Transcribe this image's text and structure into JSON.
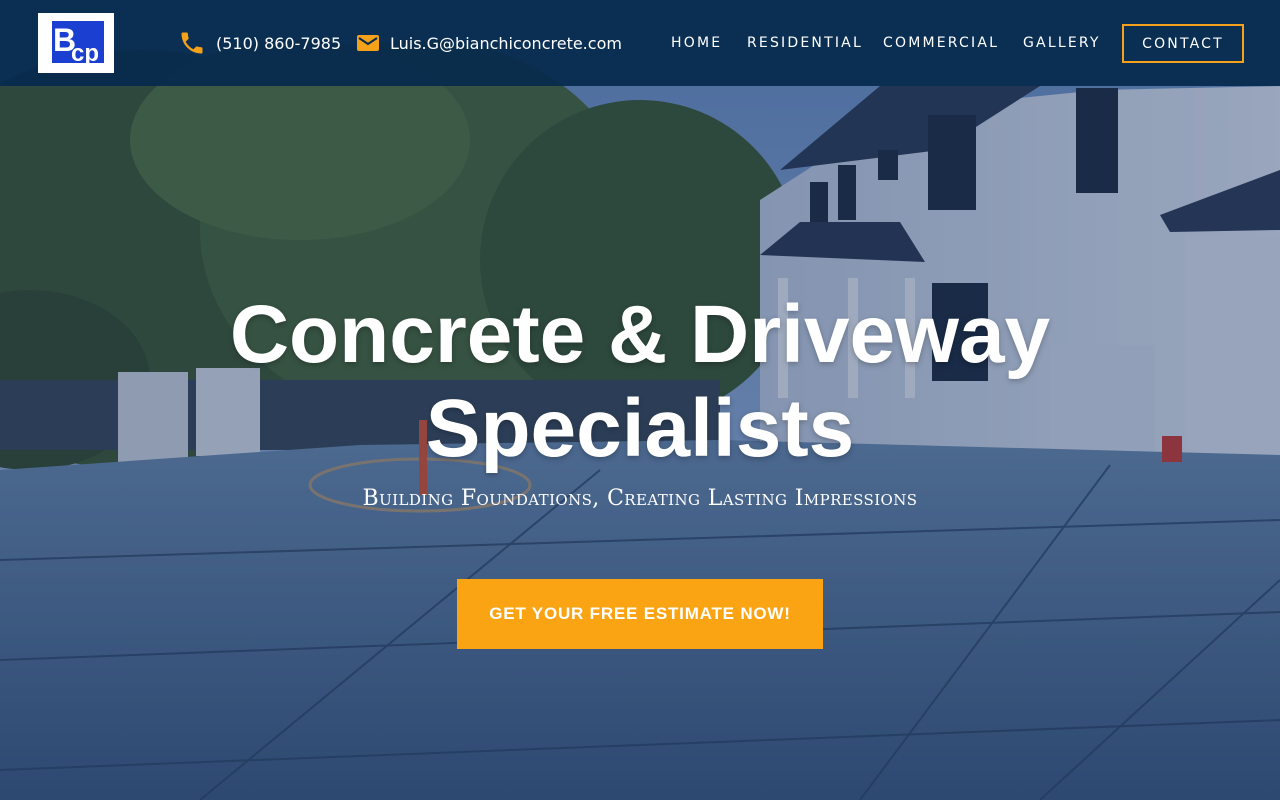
{
  "brand": {
    "logo_alt": "BCp"
  },
  "header": {
    "phone": "(510) 860-7985",
    "email": "Luis.G@bianchiconcrete.com",
    "nav": [
      {
        "label": "HOME"
      },
      {
        "label": "RESIDENTIAL"
      },
      {
        "label": "COMMERCIAL"
      },
      {
        "label": "GALLERY"
      }
    ],
    "contact_label": "CONTACT"
  },
  "hero": {
    "title_line1": "Concrete & Driveway",
    "title_line2": "Specialists",
    "subtitle": "Building Foundations, Creating Lasting Impressions",
    "cta_label": "GET YOUR FREE ESTIMATE NOW!"
  },
  "icons": {
    "phone": "phone-icon",
    "email": "mail-icon"
  },
  "colors": {
    "header_bg": "#062a4e",
    "accent": "#fba413",
    "logo_blue": "#1a3fd1",
    "text": "#ffffff"
  }
}
